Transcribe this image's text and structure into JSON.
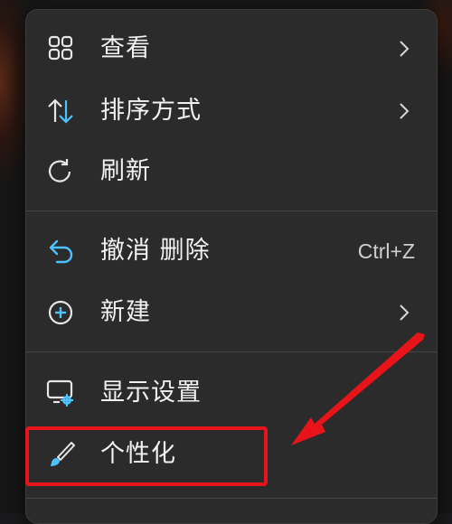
{
  "menu": {
    "items": [
      {
        "label": "查看",
        "icon": "grid-view-icon",
        "submenu": true
      },
      {
        "label": "排序方式",
        "icon": "sort-arrows-icon",
        "submenu": true
      },
      {
        "label": "刷新",
        "icon": "refresh-icon",
        "submenu": false
      },
      {
        "label": "撤消 删除",
        "icon": "undo-icon",
        "shortcut": "Ctrl+Z"
      },
      {
        "label": "新建",
        "icon": "new-plus-icon",
        "submenu": true
      },
      {
        "label": "显示设置",
        "icon": "display-settings-icon",
        "submenu": false
      },
      {
        "label": "个性化",
        "icon": "personalize-brush-icon",
        "submenu": false
      }
    ]
  },
  "annotation": {
    "highlight_color": "#e8141a",
    "highlighted_item": "个性化"
  },
  "colors": {
    "menu_bg": "#2b2b2b",
    "accent_blue": "#4cc2ff",
    "text": "#f2f2f2"
  }
}
